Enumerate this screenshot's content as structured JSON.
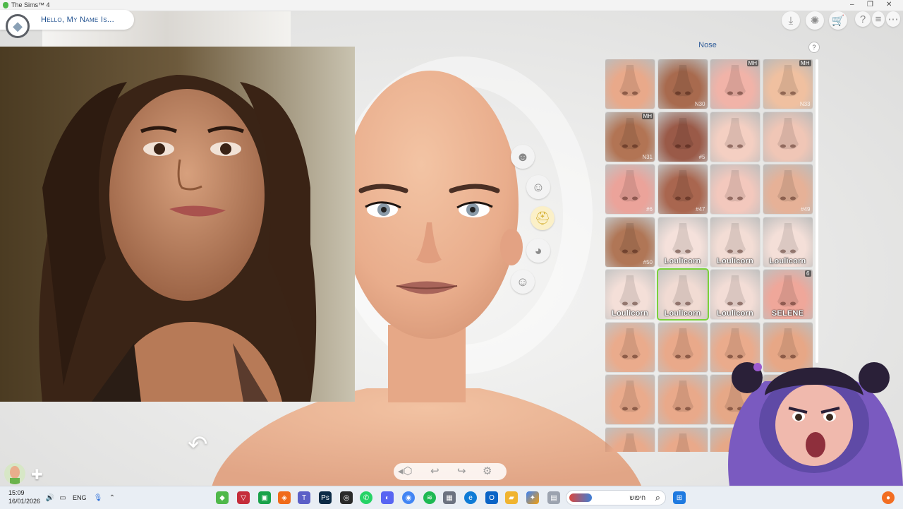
{
  "window": {
    "title": "The Sims™ 4"
  },
  "header": {
    "name_prompt": "Hello, My Name Is..."
  },
  "panel": {
    "title": "Nose",
    "help_icon": "help-icon"
  },
  "tiles": [
    {
      "badge": "",
      "label": "",
      "num": ""
    },
    {
      "badge": "",
      "label": "",
      "num": "N30"
    },
    {
      "badge": "MH",
      "label": "",
      "num": ""
    },
    {
      "badge": "MH",
      "label": "",
      "num": "N33"
    },
    {
      "badge": "MH",
      "label": "",
      "num": "N31"
    },
    {
      "badge": "",
      "label": "",
      "num": "#5"
    },
    {
      "badge": "",
      "label": "",
      "num": ""
    },
    {
      "badge": "",
      "label": "",
      "num": ""
    },
    {
      "badge": "",
      "label": "",
      "num": "#6"
    },
    {
      "badge": "",
      "label": "",
      "num": "#47"
    },
    {
      "badge": "",
      "label": "",
      "num": ""
    },
    {
      "badge": "",
      "label": "",
      "num": "#49"
    },
    {
      "badge": "",
      "label": "",
      "num": "#50"
    },
    {
      "badge": "",
      "label": "Loulicorn",
      "num": ""
    },
    {
      "badge": "",
      "label": "Loulicorn",
      "num": ""
    },
    {
      "badge": "",
      "label": "Loulicorn",
      "num": ""
    },
    {
      "badge": "",
      "label": "Loulicorn",
      "num": ""
    },
    {
      "badge": "",
      "label": "Loulicorn",
      "num": ""
    },
    {
      "badge": "",
      "label": "Loulicorn",
      "num": ""
    },
    {
      "badge": "6",
      "label": "SELENE",
      "num": ""
    },
    {
      "badge": "",
      "label": "",
      "num": ""
    },
    {
      "badge": "",
      "label": "",
      "num": ""
    },
    {
      "badge": "",
      "label": "",
      "num": ""
    },
    {
      "badge": "",
      "label": "",
      "num": ""
    },
    {
      "badge": "",
      "label": "",
      "num": ""
    },
    {
      "badge": "",
      "label": "",
      "num": ""
    },
    {
      "badge": "",
      "label": "",
      "num": ""
    },
    {
      "badge": "",
      "label": "",
      "num": ""
    },
    {
      "badge": "",
      "label": "",
      "num": ""
    },
    {
      "badge": "",
      "label": "",
      "num": ""
    },
    {
      "badge": "",
      "label": "",
      "num": ""
    },
    {
      "badge": "",
      "label": "",
      "num": ""
    }
  ],
  "taskbar": {
    "time": "15:09",
    "date": "16/01/2026",
    "language": "ENG",
    "search_text": "חיפוש"
  }
}
